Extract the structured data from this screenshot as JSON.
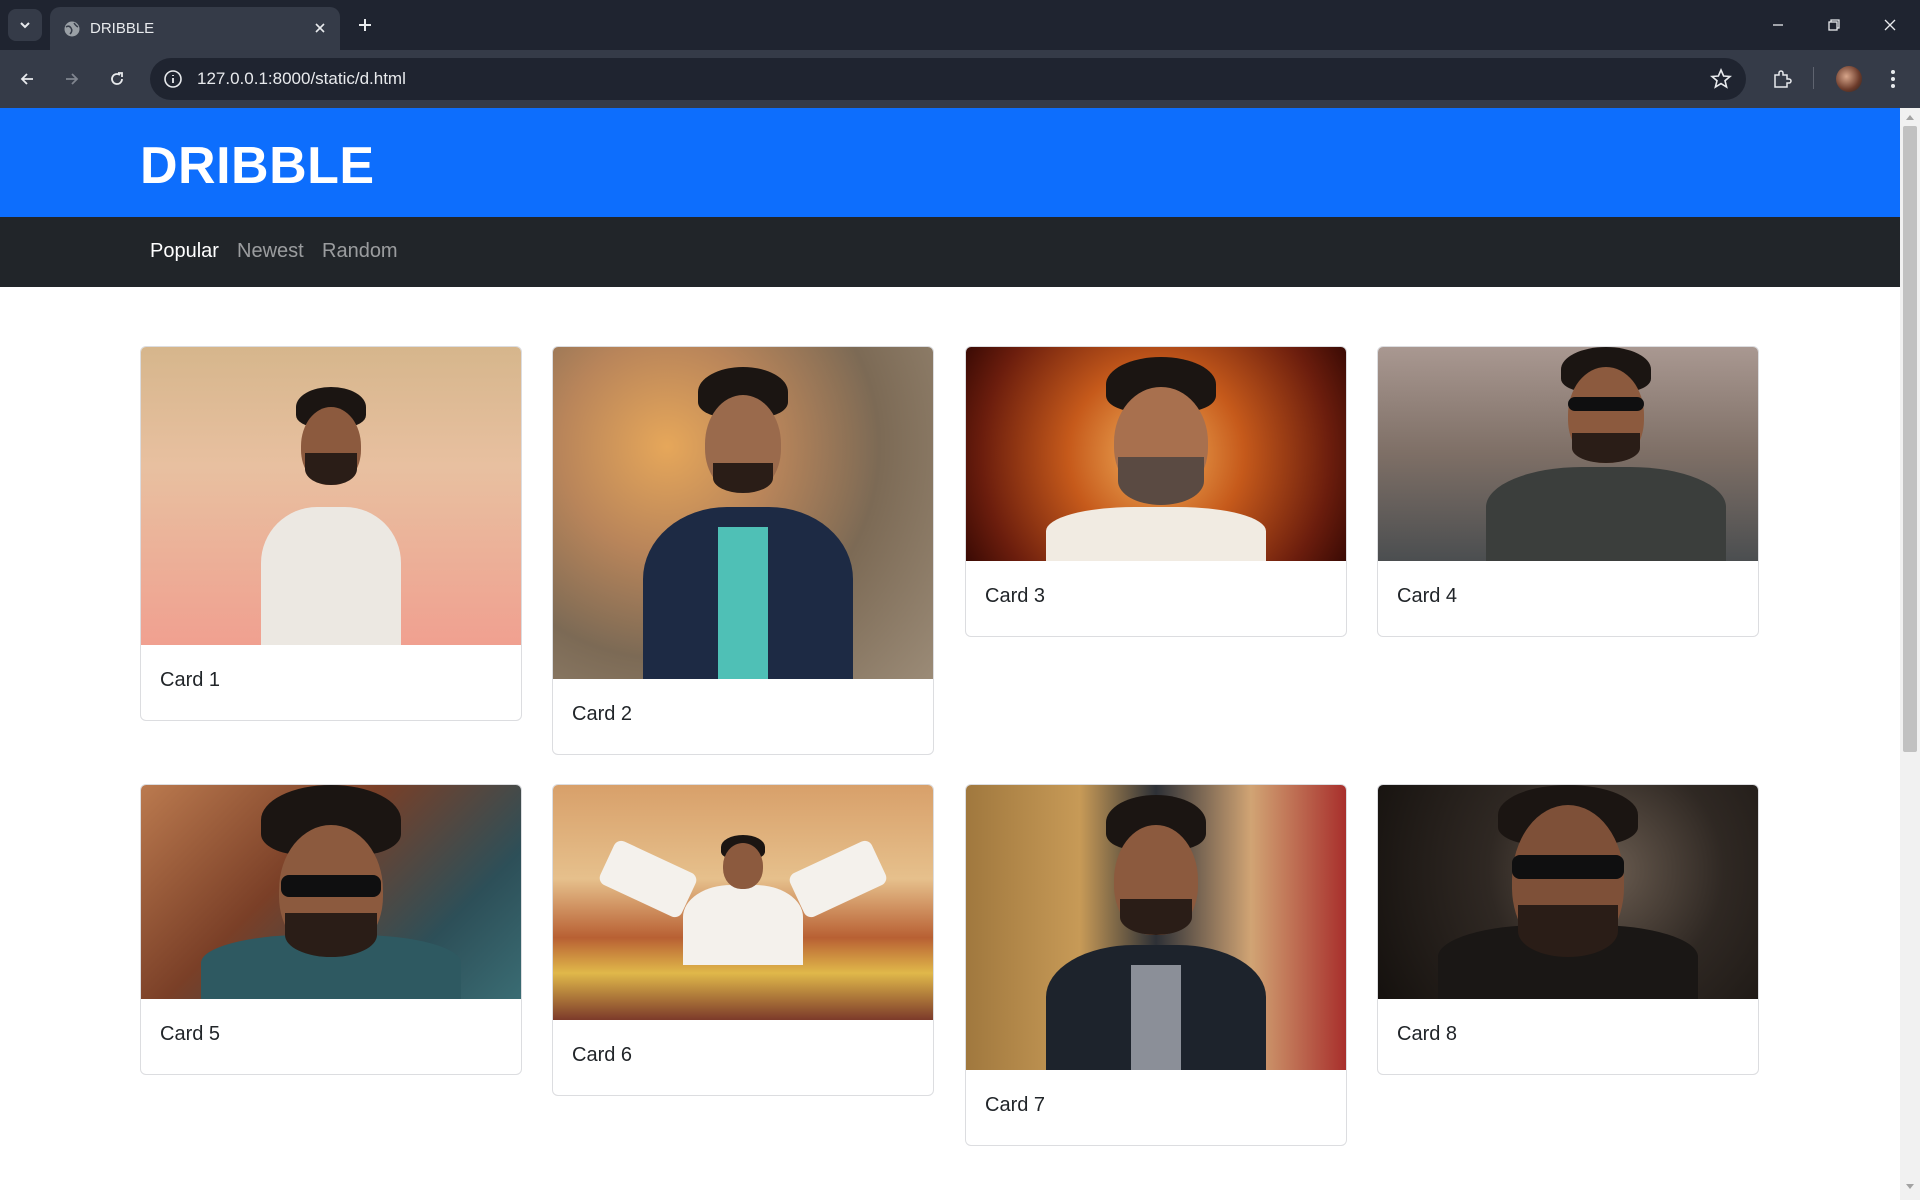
{
  "browser": {
    "tab_title": "DRIBBLE",
    "url": "127.0.0.1:8000/static/d.html"
  },
  "site": {
    "title": "DRIBBLE",
    "nav": [
      {
        "label": "Popular",
        "active": true
      },
      {
        "label": "Newest",
        "active": false
      },
      {
        "label": "Random",
        "active": false
      }
    ]
  },
  "cards": [
    {
      "title": "Card 1"
    },
    {
      "title": "Card 2"
    },
    {
      "title": "Card 3"
    },
    {
      "title": "Card 4"
    },
    {
      "title": "Card 5"
    },
    {
      "title": "Card 6"
    },
    {
      "title": "Card 7"
    },
    {
      "title": "Card 8"
    }
  ],
  "colors": {
    "header": "#0d6efd",
    "nav": "#212529"
  }
}
